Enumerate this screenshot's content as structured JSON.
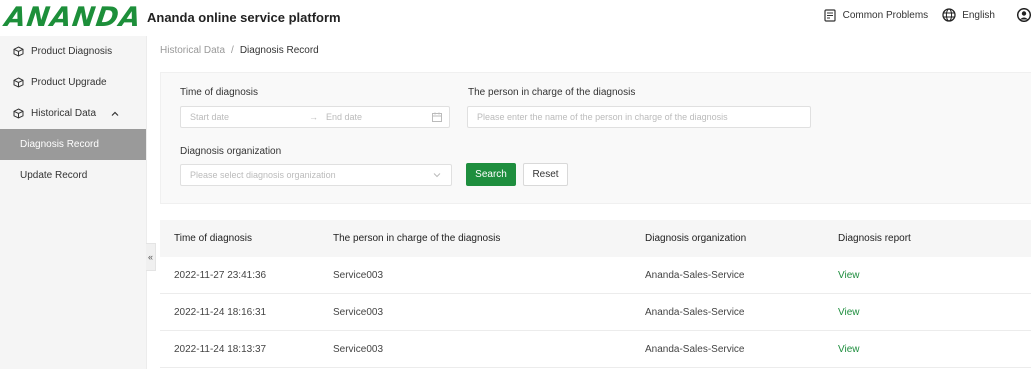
{
  "header": {
    "logo": "ANANDA",
    "title": "Ananda online service platform",
    "common_problems": "Common Problems",
    "language": "English"
  },
  "sidebar": {
    "items": [
      {
        "label": "Product Diagnosis",
        "icon": "cube-icon"
      },
      {
        "label": "Product Upgrade",
        "icon": "cube-icon"
      },
      {
        "label": "Historical Data",
        "icon": "cube-icon",
        "expanded": true
      },
      {
        "label": "Diagnosis Record",
        "active": true
      },
      {
        "label": "Update Record"
      }
    ],
    "collapse_glyph": "«"
  },
  "breadcrumb": {
    "parent": "Historical Data",
    "separator": "/",
    "current": "Diagnosis Record"
  },
  "filters": {
    "time_label": "Time of diagnosis",
    "start_placeholder": "Start date",
    "range_arrow": "→",
    "end_placeholder": "End date",
    "person_label": "The person in charge of the diagnosis",
    "person_placeholder": "Please enter the name of the person in charge of the diagnosis",
    "org_label": "Diagnosis organization",
    "org_placeholder": "Please select diagnosis organization",
    "search_button": "Search",
    "reset_button": "Reset"
  },
  "table": {
    "columns": [
      "Time of diagnosis",
      "The person in charge of the diagnosis",
      "Diagnosis organization",
      "Diagnosis report"
    ],
    "rows": [
      {
        "time": "2022-11-27 23:41:36",
        "person": "Service003",
        "org": "Ananda-Sales-Service",
        "report": "View"
      },
      {
        "time": "2022-11-24 18:16:31",
        "person": "Service003",
        "org": "Ananda-Sales-Service",
        "report": "View"
      },
      {
        "time": "2022-11-24 18:13:37",
        "person": "Service003",
        "org": "Ananda-Sales-Service",
        "report": "View"
      }
    ]
  },
  "colors": {
    "brand_green": "#1d8f3a",
    "sidebar_active": "#9a9a9a"
  }
}
